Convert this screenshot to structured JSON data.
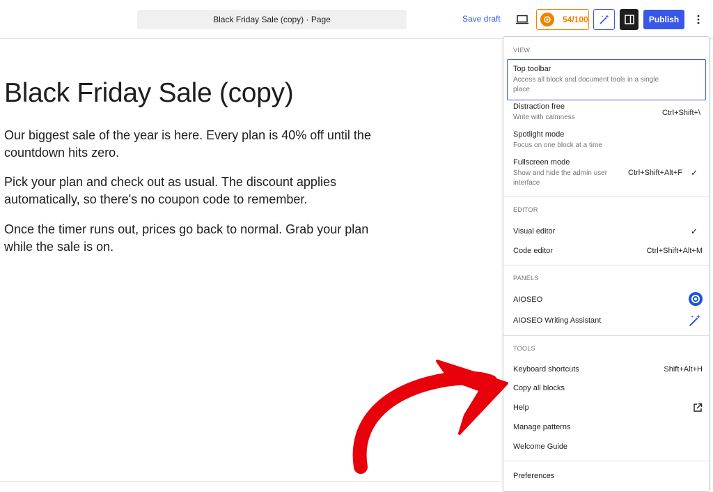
{
  "header": {
    "doc_title": "Black Friday Sale (copy) · Page",
    "save_draft": "Save draft",
    "seo_score": "54/100",
    "publish": "Publish"
  },
  "post": {
    "title": "Black Friday Sale (copy)",
    "paragraphs": [
      "Our biggest sale of the year is here. Every plan is 40% off until the countdown hits zero.",
      "Pick your plan and check out as usual. The discount applies automatically, so there's no coupon code to remember.",
      "Once the timer runs out, prices go back to normal. Grab your plan while the sale is on."
    ]
  },
  "menu": {
    "view": {
      "label": "View",
      "items": [
        {
          "label": "Top toolbar",
          "desc": "Access all block and document tools in a single place",
          "shortcut": ""
        },
        {
          "label": "Distraction free",
          "desc": "Write with calmness",
          "shortcut": "Ctrl+Shift+\\"
        },
        {
          "label": "Spotlight mode",
          "desc": "Focus on one block at a time",
          "shortcut": ""
        },
        {
          "label": "Fullscreen mode",
          "desc": "Show and hide the admin user interface",
          "shortcut": "Ctrl+Shift+Alt+F"
        }
      ]
    },
    "editor": {
      "label": "Editor",
      "items": [
        {
          "label": "Visual editor",
          "shortcut": ""
        },
        {
          "label": "Code editor",
          "shortcut": "Ctrl+Shift+Alt+M"
        }
      ]
    },
    "panels": {
      "label": "Panels",
      "items": [
        {
          "label": "AIOSEO"
        },
        {
          "label": "AIOSEO Writing Assistant"
        }
      ]
    },
    "tools": {
      "label": "Tools",
      "items": [
        {
          "label": "Keyboard shortcuts",
          "shortcut": "Shift+Alt+H"
        },
        {
          "label": "Copy all blocks"
        },
        {
          "label": "Help"
        },
        {
          "label": "Manage patterns"
        },
        {
          "label": "Welcome Guide"
        }
      ]
    },
    "preferences": "Preferences"
  },
  "colors": {
    "accent": "#3858e9",
    "seo_orange": "#f18200",
    "arrow_red": "#e8000b"
  },
  "icons": {
    "preview": "desktop-icon",
    "score": "aioseo-logo-icon",
    "wand": "magic-wand-icon",
    "sidebar": "sidebar-toggle-icon",
    "more": "vertical-ellipsis-icon",
    "check": "checkmark-icon",
    "external": "external-link-icon"
  }
}
